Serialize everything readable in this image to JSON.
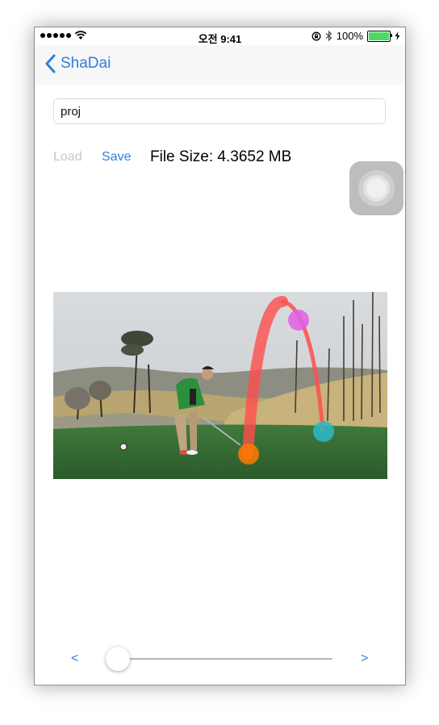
{
  "status_bar": {
    "carrier_dots": 5,
    "time": "오전 9:41",
    "battery_percent": "100%",
    "battery_fill": 1.0,
    "icons": [
      "signal-dots",
      "wifi-icon",
      "orientation-lock-icon",
      "bluetooth-icon",
      "battery-icon",
      "charging-bolt-icon"
    ]
  },
  "nav": {
    "back_label": "ShaDai",
    "back_icon": "chevron-left-icon"
  },
  "project": {
    "name_value": "proj"
  },
  "toolbar": {
    "load_label": "Load",
    "save_label": "Save",
    "file_size": "File Size: 4.3652 MB"
  },
  "video": {
    "description": "golf swing frame with ball-trajectory overlay",
    "markers": [
      {
        "name": "start",
        "color": "#ff7a00"
      },
      {
        "name": "apex",
        "color": "#e05ee6"
      },
      {
        "name": "landing",
        "color": "#2bbac8"
      }
    ]
  },
  "scrubber": {
    "prev_label": "<",
    "next_label": ">",
    "position": 0.0
  },
  "colors": {
    "accent": "#2f7fe0",
    "disabled": "#c8c8c8",
    "battery": "#4cd964"
  }
}
